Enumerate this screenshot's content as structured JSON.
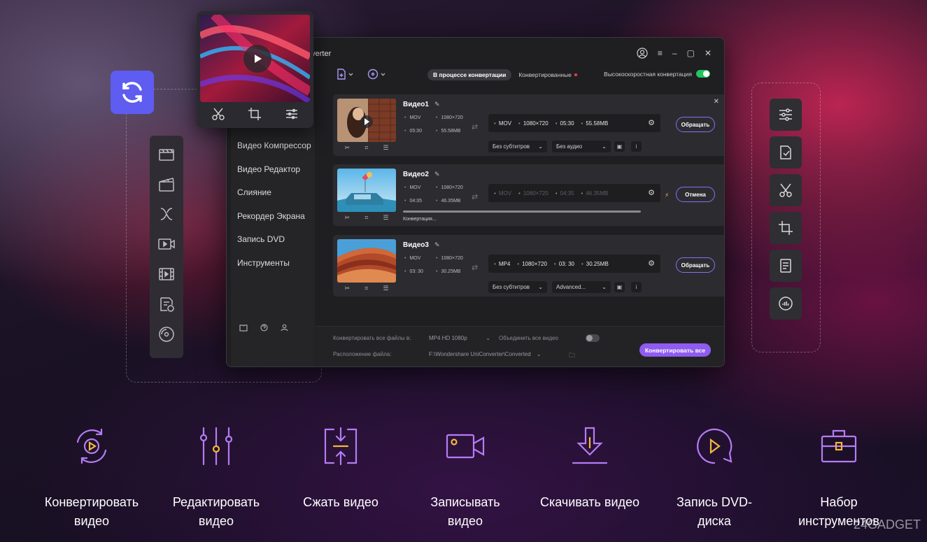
{
  "window": {
    "title": "nverter",
    "tabs": {
      "active": "В процессе конвертации",
      "converted": "Конвертированные"
    },
    "high_speed_label": "Высокоскоростная конвертация"
  },
  "sidebar": {
    "items": [
      "Видео Компрессор",
      "Видео Редактор",
      "Слияние",
      "Рекордер Экрана",
      "Запись DVD",
      "Инструменты"
    ]
  },
  "videos": [
    {
      "name": "Видео1",
      "src_format": "MOV",
      "src_res": "1080×720",
      "src_dur": "05:30",
      "src_size": "55.58MB",
      "dst_format": "MOV",
      "dst_res": "1080×720",
      "dst_dur": "05:30",
      "dst_size": "55.58MB",
      "subtitle": "Без субтитров",
      "audio": "Без аудио",
      "button": "Обращать"
    },
    {
      "name": "Видео2",
      "src_format": "MOV",
      "src_res": "1080×720",
      "src_dur": "04:35",
      "src_size": "46.35MB",
      "dst_format": "MOV",
      "dst_res": "1080×720",
      "dst_dur": "04:35",
      "dst_size": "46.35MB",
      "status": "Конвертация...",
      "progress": 1.0,
      "button": "Отмена"
    },
    {
      "name": "Видео3",
      "src_format": "MOV",
      "src_res": "1080×720",
      "src_dur": "03: 30",
      "src_size": "30.25MB",
      "dst_format": "MP4",
      "dst_res": "1080×720",
      "dst_dur": "03: 30",
      "dst_size": "30.25MB",
      "subtitle": "Без субтитров",
      "audio": "Advanced...",
      "button": "Обращать"
    }
  ],
  "bottom": {
    "convert_all_label": "Конвертировать все файлы в:",
    "convert_all_value": "MP4 HD 1080p",
    "merge_label": "Объединить все видео",
    "location_label": "Расположение файла:",
    "location_value": "F:\\Wondershare UniConverter\\Converted",
    "convert_all_button": "Конвертировать все"
  },
  "features": [
    {
      "line1": "Конвертировать",
      "line2": "видео",
      "icon": "convert-video-icon"
    },
    {
      "line1": "Редактировать",
      "line2": "видео",
      "icon": "edit-sliders-icon"
    },
    {
      "line1": "Сжать видео",
      "line2": "",
      "icon": "compress-icon"
    },
    {
      "line1": "Записывать",
      "line2": "видео",
      "icon": "camera-icon"
    },
    {
      "line1": "Скачивать видео",
      "line2": "",
      "icon": "download-icon"
    },
    {
      "line1": "Запись DVD-",
      "line2": "диска",
      "icon": "dvd-icon"
    },
    {
      "line1": "Набор",
      "line2": "инструментов",
      "icon": "toolbox-icon"
    }
  ],
  "watermark": "24GADGET",
  "colors": {
    "accent": "#8f5bf0",
    "badge": "#5f5cf1",
    "feature_stroke": "#b57cf5",
    "feature_highlight": "#f4b740",
    "toggle_on": "#22c55e"
  }
}
